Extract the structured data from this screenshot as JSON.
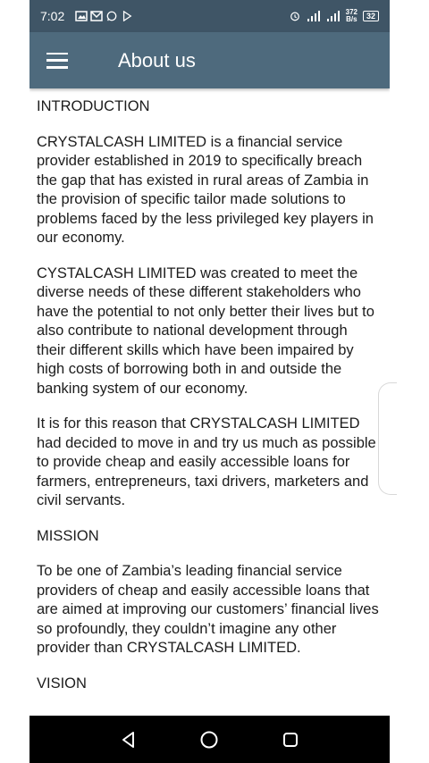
{
  "status_bar": {
    "time": "7:02",
    "net_speed_value": "372",
    "net_speed_unit": "B/s",
    "battery": "32",
    "icons": [
      "gallery-icon",
      "gmail-icon",
      "whatsapp-icon",
      "play-store-icon",
      "alarm-icon",
      "signal-icon",
      "signal-4g-icon"
    ]
  },
  "app_bar": {
    "title": "About us",
    "menu_icon": "hamburger-menu-icon",
    "background": "#4e6a7d"
  },
  "content": {
    "intro_heading": "INTRODUCTION",
    "intro_p1": "CRYSTALCASH LIMITED is a financial service provider established in 2019 to specifically breach the gap that has existed in rural areas of Zambia in the provision of specific tailor made solutions to problems faced by the less privileged key players in our economy.",
    "intro_p2": "CYSTALCASH LIMITED was created to meet the diverse needs of these different stakeholders who have the potential to not only better their lives but to also contribute to national development through their different skills which have been impaired by high costs of borrowing both in and outside the banking system of our economy.",
    "intro_p3": "It is for this reason that CRYSTALCASH LIMITED had decided to move in and try us much as possible to provide cheap and easily accessible loans for farmers, entrepreneurs, taxi drivers, marketers and civil servants.",
    "mission_heading": "MISSION",
    "mission_p1": "To be one of Zambia’s leading financial service providers of cheap and easily accessible loans that are aimed at improving our customers’ financial lives so profoundly, they couldn’t imagine any other provider than CRYSTALCASH LIMITED.",
    "vision_heading_partial": "VISION"
  },
  "nav_bar": {
    "buttons": [
      "back-icon",
      "home-icon",
      "recents-icon"
    ]
  }
}
